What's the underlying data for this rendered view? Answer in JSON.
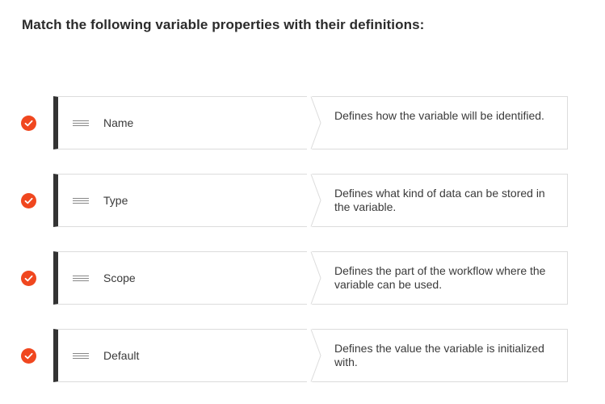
{
  "question": {
    "title": "Match the following variable properties with their definitions:"
  },
  "colors": {
    "accent": "#f0471f",
    "term_bar": "#333333",
    "border": "#dcdcdc"
  },
  "pairs": [
    {
      "status": "correct",
      "status_icon": "check-circle-icon",
      "term": "Name",
      "definition": "Defines how the variable will be identified."
    },
    {
      "status": "correct",
      "status_icon": "check-circle-icon",
      "term": "Type",
      "definition": "Defines what kind of data can be stored in the variable."
    },
    {
      "status": "correct",
      "status_icon": "check-circle-icon",
      "term": "Scope",
      "definition": "Defines the part of the workflow where the variable can be used."
    },
    {
      "status": "correct",
      "status_icon": "check-circle-icon",
      "term": "Default",
      "definition": "Defines the value the variable is initialized with."
    }
  ]
}
